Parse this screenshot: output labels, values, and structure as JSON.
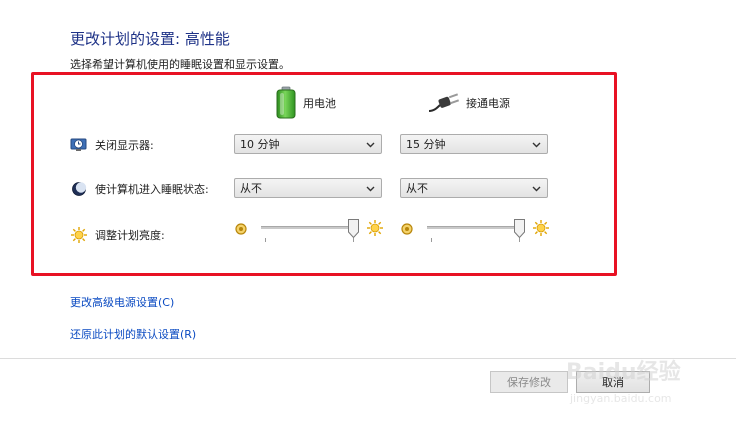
{
  "page": {
    "title": "更改计划的设置: 高性能",
    "subtitle": "选择希望计算机使用的睡眠设置和显示设置。"
  },
  "columns": {
    "battery": {
      "label": "用电池",
      "icon": "battery-icon"
    },
    "plugged": {
      "label": "接通电源",
      "icon": "power-plug-icon"
    }
  },
  "rows": {
    "display_off": {
      "label": "关闭显示器:",
      "icon": "monitor-clock-icon",
      "battery_value": "10 分钟",
      "plugged_value": "15 分钟"
    },
    "sleep": {
      "label": "使计算机进入睡眠状态:",
      "icon": "moon-icon",
      "battery_value": "从不",
      "plugged_value": "从不"
    },
    "brightness": {
      "label": "调整计划亮度:",
      "icon": "sun-icon",
      "battery_level": 1.0,
      "plugged_level": 1.0
    }
  },
  "links": {
    "advanced": "更改高级电源设置(C)",
    "restore": "还原此计划的默认设置(R)"
  },
  "buttons": {
    "save": "保存修改",
    "cancel": "取消"
  },
  "watermark": {
    "logo": "Baidu经验",
    "url": "jingyan.baidu.com"
  },
  "colors": {
    "title": "#1e3287",
    "link": "#0a4ac2",
    "highlight": "#e81123",
    "battery_green": "#3fae2a"
  }
}
